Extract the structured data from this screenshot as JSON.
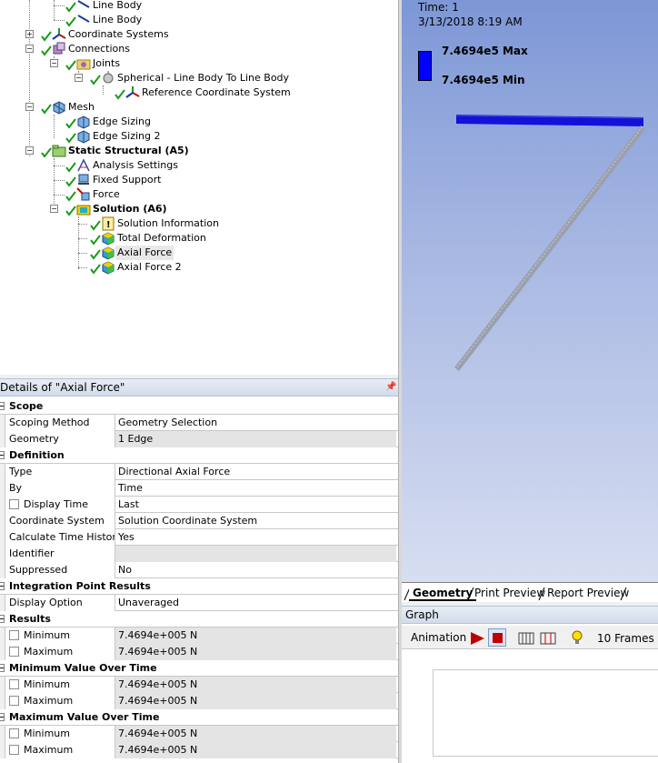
{
  "tree": {
    "items": [
      {
        "label": "Line Body"
      },
      {
        "label": "Line Body"
      },
      {
        "label": "Coordinate Systems"
      },
      {
        "label": "Connections"
      },
      {
        "label": "Joints"
      },
      {
        "label": "Spherical - Line Body To Line Body"
      },
      {
        "label": "Reference Coordinate System"
      },
      {
        "label": "Mesh"
      },
      {
        "label": "Edge Sizing"
      },
      {
        "label": "Edge Sizing 2"
      },
      {
        "label": "Static Structural (A5)"
      },
      {
        "label": "Analysis Settings"
      },
      {
        "label": "Fixed Support"
      },
      {
        "label": "Force"
      },
      {
        "label": "Solution (A6)"
      },
      {
        "label": "Solution Information"
      },
      {
        "label": "Total Deformation"
      },
      {
        "label": "Axial Force"
      },
      {
        "label": "Axial Force 2"
      }
    ]
  },
  "details": {
    "title": "Details of \"Axial Force\"",
    "sections": {
      "scope": "Scope",
      "definition": "Definition",
      "integration": "Integration Point Results",
      "results": "Results",
      "min_over_time": "Minimum Value Over Time",
      "max_over_time": "Maximum Value Over Time"
    },
    "rows": {
      "scoping_method": {
        "key": "Scoping Method",
        "value": "Geometry Selection"
      },
      "geometry": {
        "key": "Geometry",
        "value": "1 Edge"
      },
      "type": {
        "key": "Type",
        "value": "Directional Axial Force"
      },
      "by": {
        "key": "By",
        "value": "Time"
      },
      "display_time": {
        "key": "Display Time",
        "value": "Last"
      },
      "coord_system": {
        "key": "Coordinate System",
        "value": "Solution Coordinate System"
      },
      "calc_time_history": {
        "key": "Calculate Time History",
        "value": "Yes"
      },
      "identifier": {
        "key": "Identifier",
        "value": ""
      },
      "suppressed": {
        "key": "Suppressed",
        "value": "No"
      },
      "display_option": {
        "key": "Display Option",
        "value": "Unaveraged"
      },
      "res_min": {
        "key": "Minimum",
        "value": "7.4694e+005 N"
      },
      "res_max": {
        "key": "Maximum",
        "value": "7.4694e+005 N"
      },
      "mvot_min": {
        "key": "Minimum",
        "value": "7.4694e+005 N"
      },
      "mvot_max": {
        "key": "Maximum",
        "value": "7.4694e+005 N"
      },
      "xvot_min": {
        "key": "Minimum",
        "value": "7.4694e+005 N"
      },
      "xvot_max": {
        "key": "Maximum",
        "value": "7.4694e+005 N"
      }
    }
  },
  "viewport": {
    "time": "Time: 1",
    "date": "3/13/2018 8:19 AM",
    "legend_max": "7.4694e5 Max",
    "legend_min": "7.4694e5 Min",
    "legend_color": "#0000ff"
  },
  "view_tabs": {
    "geometry": "Geometry",
    "print_preview": "Print Preview",
    "report_preview": "Report Preview"
  },
  "graph": {
    "title": "Graph",
    "animation_label": "Animation",
    "frames_label": "10 Frames"
  },
  "colors": {
    "check_green": "#1a9a1a",
    "solution_yellow": "#f0d000",
    "mesh_cyan": "#20b0c0"
  }
}
